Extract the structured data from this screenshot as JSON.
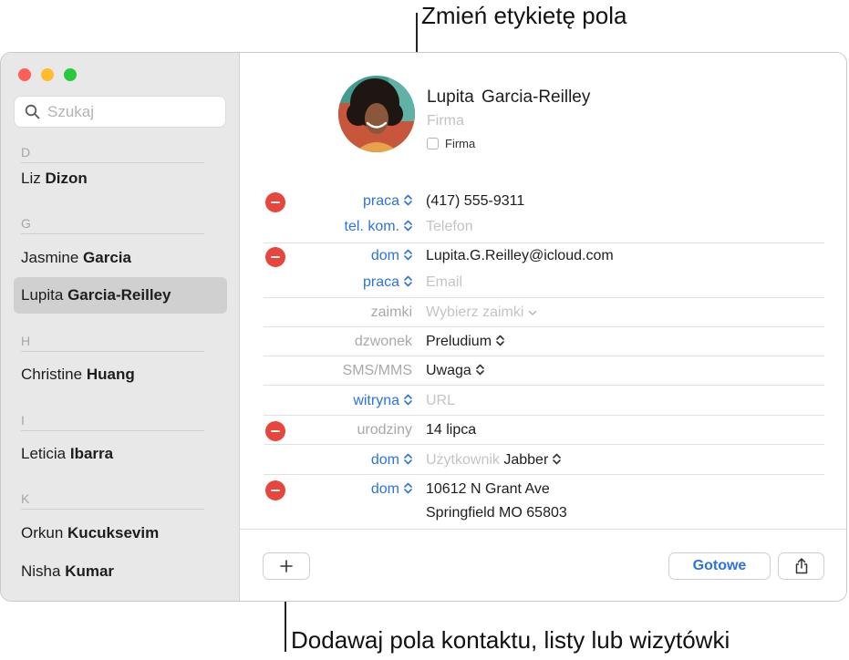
{
  "callouts": {
    "top": "Zmień etykietę pola",
    "bottom": "Dodawaj pola kontaktu, listy lub wizytówki"
  },
  "sidebar": {
    "search_placeholder": "Szukaj",
    "sections": [
      {
        "letter": "D",
        "contacts": [
          {
            "first": "Liz",
            "last": "Dizon"
          }
        ]
      },
      {
        "letter": "G",
        "contacts": [
          {
            "first": "Jasmine",
            "last": "Garcia"
          },
          {
            "first": "Lupita",
            "last": "Garcia-Reilley",
            "selected": true
          }
        ]
      },
      {
        "letter": "H",
        "contacts": [
          {
            "first": "Christine",
            "last": "Huang"
          }
        ]
      },
      {
        "letter": "I",
        "contacts": [
          {
            "first": "Leticia",
            "last": "Ibarra"
          }
        ]
      },
      {
        "letter": "K",
        "contacts": [
          {
            "first": "Orkun",
            "last": "Kucuksevim"
          },
          {
            "first": "Nisha",
            "last": "Kumar"
          }
        ]
      }
    ]
  },
  "card": {
    "name": "Lupita  Garcia-Reilley",
    "company_placeholder": "Firma",
    "company_checkbox_label": "Firma",
    "fields": [
      {
        "label": "praca",
        "value": "(417) 555-9311"
      },
      {
        "label": "tel. kom.",
        "value": "Telefon"
      },
      {
        "label": "dom",
        "value": "Lupita.G.Reilley@icloud.com"
      },
      {
        "label": "praca",
        "value": "Email"
      },
      {
        "label": "zaimki",
        "value": "Wybierz zaimki"
      },
      {
        "label": "dzwonek",
        "value": "Preludium"
      },
      {
        "label": "SMS/MMS",
        "value": "Uwaga"
      },
      {
        "label": "witryna",
        "value": "URL"
      },
      {
        "label": "urodziny",
        "value": "14 lipca"
      },
      {
        "label": "dom",
        "value": "Użytkownik",
        "service": "Jabber"
      },
      {
        "label": "dom",
        "value": "10612 N Grant Ave",
        "value2": "Springfield MO 65803"
      }
    ]
  },
  "footer": {
    "add_label": "+",
    "done_label": "Gotowe"
  },
  "colors": {
    "accent": "#2b73e3",
    "delete": "#e8453c",
    "sidebar_bg": "#e8e8e8",
    "selection_bg": "#d0d0d0"
  }
}
